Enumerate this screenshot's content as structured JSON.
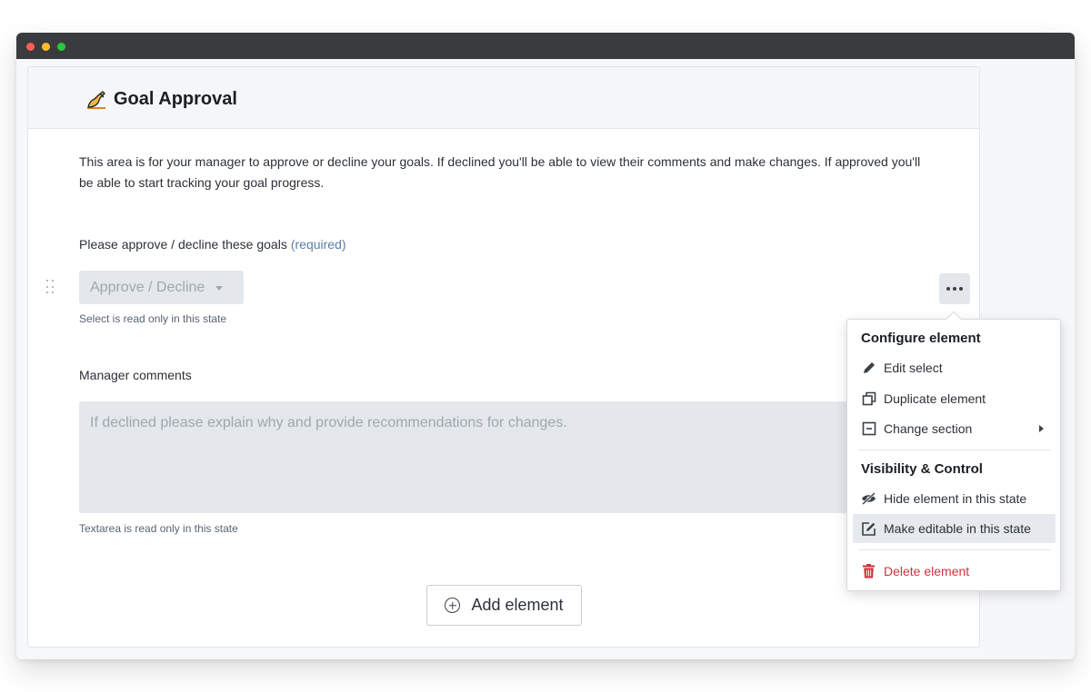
{
  "window": {
    "controls": [
      "close",
      "minimize",
      "maximize"
    ]
  },
  "card": {
    "title": "Goal Approval",
    "title_icon": "writing-hand-icon",
    "intro": "This area is for your manager to approve or decline your goals. If declined you'll be able to view their comments and make changes. If approved you'll be able to start tracking your goal progress."
  },
  "approval_field": {
    "label": "Please approve / decline these goals",
    "required_text": "(required)",
    "placeholder": "Approve / Decline",
    "help": "Select is read only in this state"
  },
  "comments_field": {
    "label": "Manager comments",
    "placeholder": "If declined please explain why and provide recommendations for changes.",
    "help": "Textarea is read only in this state"
  },
  "add_element": {
    "label": "Add element"
  },
  "menu": {
    "section1_title": "Configure element",
    "items1": [
      {
        "label": "Edit select",
        "icon": "pencil-icon"
      },
      {
        "label": "Duplicate element",
        "icon": "duplicate-icon"
      },
      {
        "label": "Change section",
        "icon": "section-icon",
        "has_submenu": true
      }
    ],
    "section2_title": "Visibility & Control",
    "items2": [
      {
        "label": "Hide element in this state",
        "icon": "eye-slash-icon"
      },
      {
        "label": "Make editable in this state",
        "icon": "edit-square-icon",
        "active": true
      }
    ],
    "delete": {
      "label": "Delete element",
      "icon": "trash-icon"
    }
  },
  "colors": {
    "accent_required": "#5b7ea6",
    "danger": "#d1333b",
    "readonly_fill": "#e4e8ec"
  }
}
